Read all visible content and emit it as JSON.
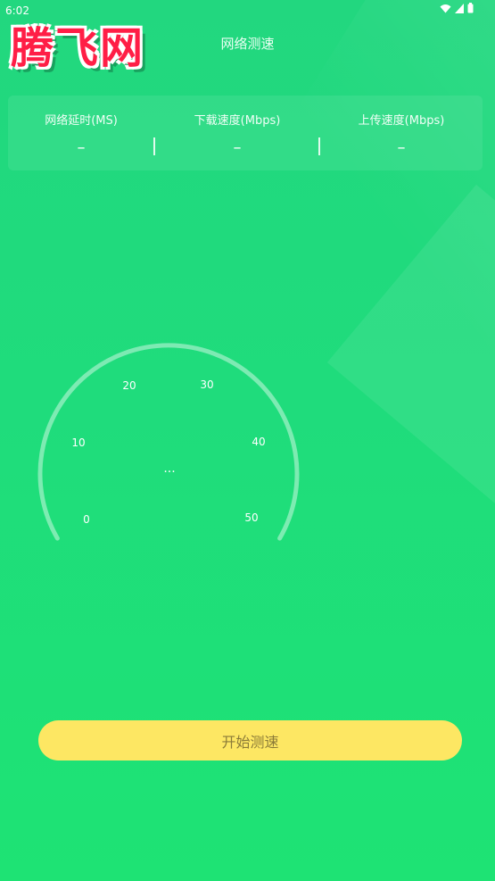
{
  "status_bar": {
    "time": "6:02"
  },
  "watermark": "腾飞网",
  "header": {
    "title": "网络测速"
  },
  "stats": [
    {
      "label": "网络延时(MS)",
      "value": "–"
    },
    {
      "label": "下载速度(Mbps)",
      "value": "–"
    },
    {
      "label": "上传速度(Mbps)",
      "value": "–"
    }
  ],
  "gauge": {
    "ticks": [
      "0",
      "10",
      "20",
      "30",
      "40",
      "50"
    ],
    "center": "···"
  },
  "start_button": {
    "label": "开始测速"
  },
  "colors": {
    "background": "#1fdc7c",
    "button": "#fde763",
    "button_text": "#8b7b38",
    "watermark": "#ff1e46"
  }
}
